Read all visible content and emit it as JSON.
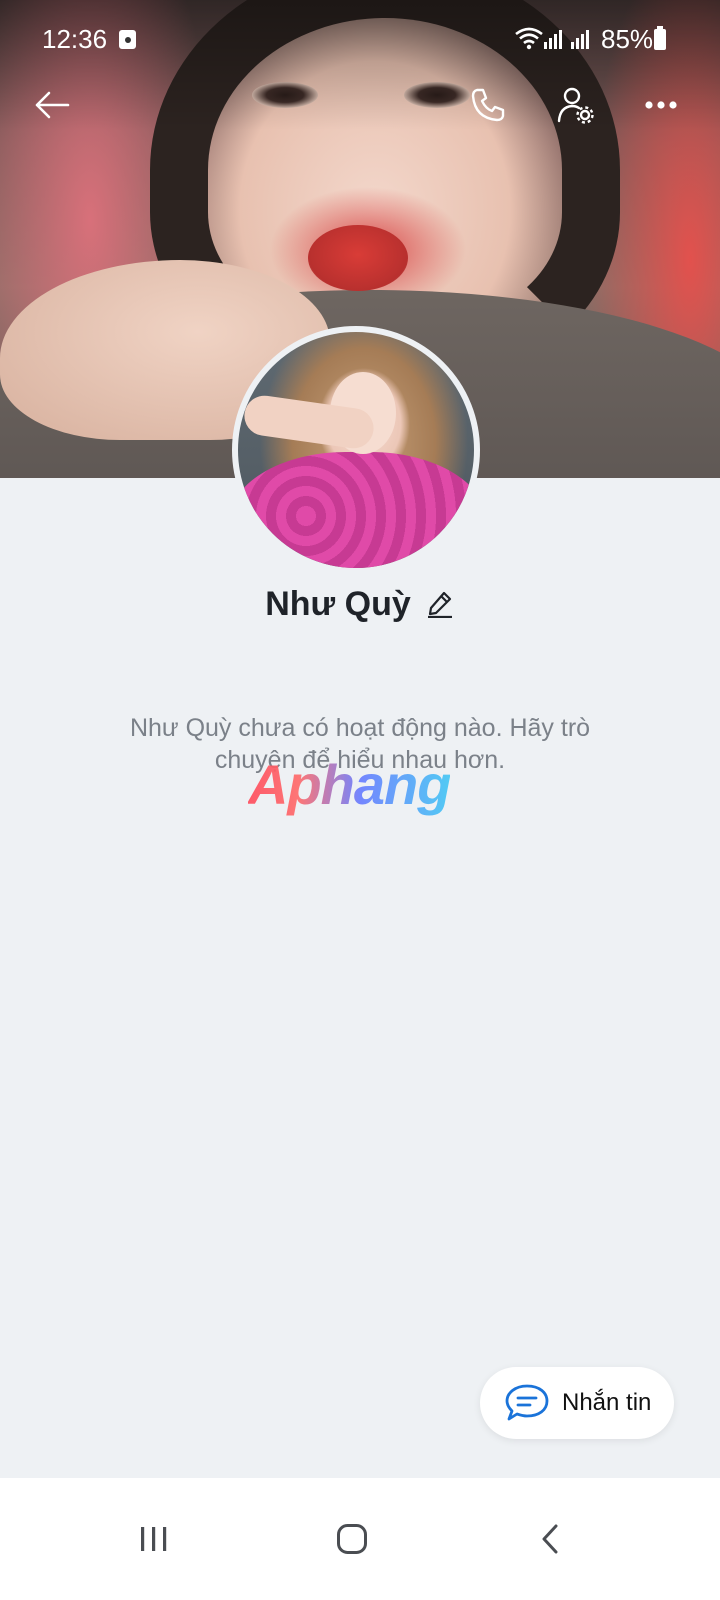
{
  "status_bar": {
    "time": "12:36",
    "battery": "85%",
    "icons": [
      "notification-icon",
      "wifi-icon",
      "signal-icon",
      "signal-icon",
      "battery-icon"
    ]
  },
  "header": {
    "icons": [
      "back-arrow-icon",
      "phone-icon",
      "user-settings-icon",
      "more-icon"
    ]
  },
  "profile": {
    "name": "Như Quỳ",
    "empty_message": "Như Quỳ chưa có hoạt động nào. Hãy trò chuyện để hiểu nhau hơn."
  },
  "watermark": "Aphang",
  "message_button": {
    "label": "Nhắn tin",
    "icon": "chat-bubble-icon",
    "accent": "#1a73d9"
  },
  "navigation": {
    "icons": [
      "recent-apps-icon",
      "home-icon",
      "back-icon"
    ]
  },
  "colors": {
    "background": "#eef1f4",
    "text_primary": "#1f2329",
    "text_secondary": "#7b8189"
  }
}
